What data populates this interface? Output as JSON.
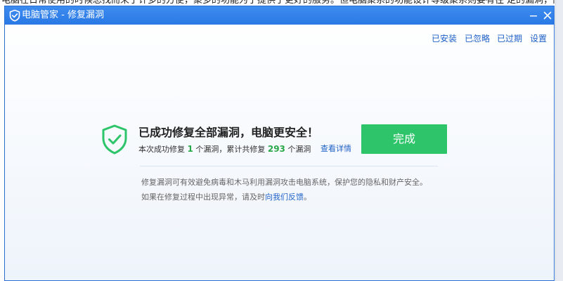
{
  "background_doc": {
    "text": "电脑在日常使用的时候总找而来了许多的方便，聚多的功能为了提供了更好的服务。但电脑聚系的功能设计等级聚系则要有往  定的漏洞，而这些漏洞就是"
  },
  "window": {
    "title": "电脑管家 - 修复漏洞",
    "top_links": {
      "installed": "已安装",
      "ignored": "已忽略",
      "expired": "已过期",
      "settings": "设置"
    },
    "result": {
      "title": "已成功修复全部漏洞，电脑更安全！",
      "detail_prefix": "本次成功修复",
      "fixed_count": "1",
      "detail_middle": "个漏洞，累计共修复",
      "total_count": "293",
      "detail_suffix": "个漏洞",
      "view_details": "查看详情"
    },
    "done_button": "完成",
    "info": {
      "line1": "修复漏洞可有效避免病毒和木马利用漏洞攻击电脑系统，保护您的隐私和财产安全。",
      "line2_prefix": "如果在修复过程中出现异常，请及时",
      "line2_link": "向我们反馈",
      "line2_suffix": "。"
    }
  },
  "colors": {
    "titlebar": "#2a78e4",
    "link_blue": "#1f61c7",
    "success_green": "#2ec56a",
    "count_green": "#2aa84a"
  },
  "icons": {
    "title_logo": "shield-logo-icon",
    "minimize": "minimize-icon",
    "close": "close-icon",
    "result": "shield-check-icon"
  }
}
